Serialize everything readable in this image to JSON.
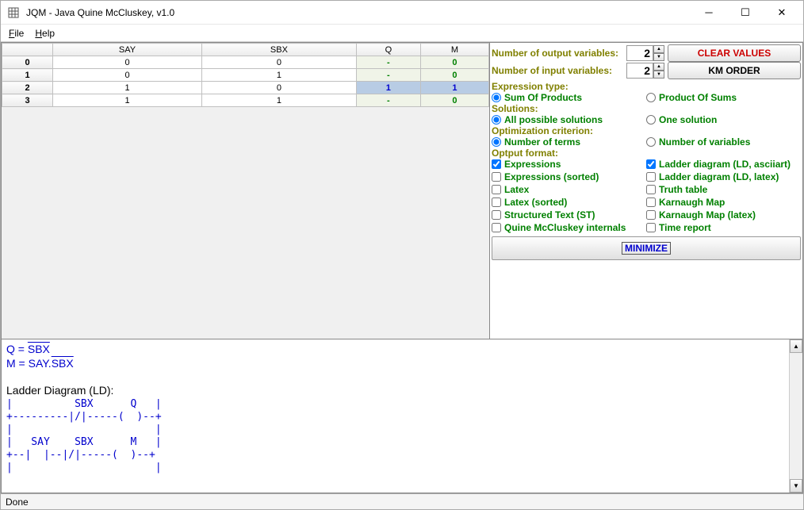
{
  "window": {
    "title": "JQM - Java Quine McCluskey, v1.0"
  },
  "menu": {
    "file": "File",
    "help": "Help"
  },
  "table": {
    "headers": [
      "",
      "SAY",
      "SBX",
      "Q",
      "M"
    ],
    "rows": [
      {
        "idx": "0",
        "say": "0",
        "sbx": "0",
        "q": "-",
        "m": "0"
      },
      {
        "idx": "1",
        "say": "0",
        "sbx": "1",
        "q": "-",
        "m": "0"
      },
      {
        "idx": "2",
        "say": "1",
        "sbx": "0",
        "q": "1",
        "m": "1"
      },
      {
        "idx": "3",
        "say": "1",
        "sbx": "1",
        "q": "-",
        "m": "0"
      }
    ]
  },
  "panel": {
    "out_vars_label": "Number of output variables:",
    "out_vars_value": "2",
    "in_vars_label": "Number  of  input  variables:",
    "in_vars_value": "2",
    "clear_btn": "CLEAR VALUES",
    "km_btn": "KM ORDER",
    "expr_type_label": "Expression type:",
    "sop": "Sum Of Products",
    "pos": "Product Of Sums",
    "solutions_label": "Solutions:",
    "all_sol": "All possible solutions",
    "one_sol": "One solution",
    "opt_label": "Optimization criterion:",
    "num_terms": "Number of terms",
    "num_vars": "Number of variables",
    "outfmt_label": "Optput format:",
    "fmt_expr": "Expressions",
    "fmt_ld_ascii": "Ladder diagram (LD, asciiart)",
    "fmt_expr_sorted": "Expressions (sorted)",
    "fmt_ld_latex": "Ladder diagram (LD, latex)",
    "fmt_latex": "Latex",
    "fmt_truth": "Truth table",
    "fmt_latex_sorted": "Latex (sorted)",
    "fmt_kmap": "Karnaugh Map",
    "fmt_st": "Structured Text (ST)",
    "fmt_kmap_latex": "Karnaugh Map (latex)",
    "fmt_qm": "Quine McCluskey internals",
    "fmt_time": "Time report",
    "minimize": "MINIMIZE"
  },
  "output": {
    "q_prefix": "Q = ",
    "q_over": "SBX",
    "m_prefix": "M = SAY.",
    "m_over": "SBX",
    "section": "Ladder Diagram (LD):",
    "ld": "|          SBX      Q   |\n+---------|/|-----(  )--+\n|                       |\n|   SAY    SBX      M   |\n+--|  |--|/|-----(  )--+\n|                       |"
  },
  "status": "Done"
}
